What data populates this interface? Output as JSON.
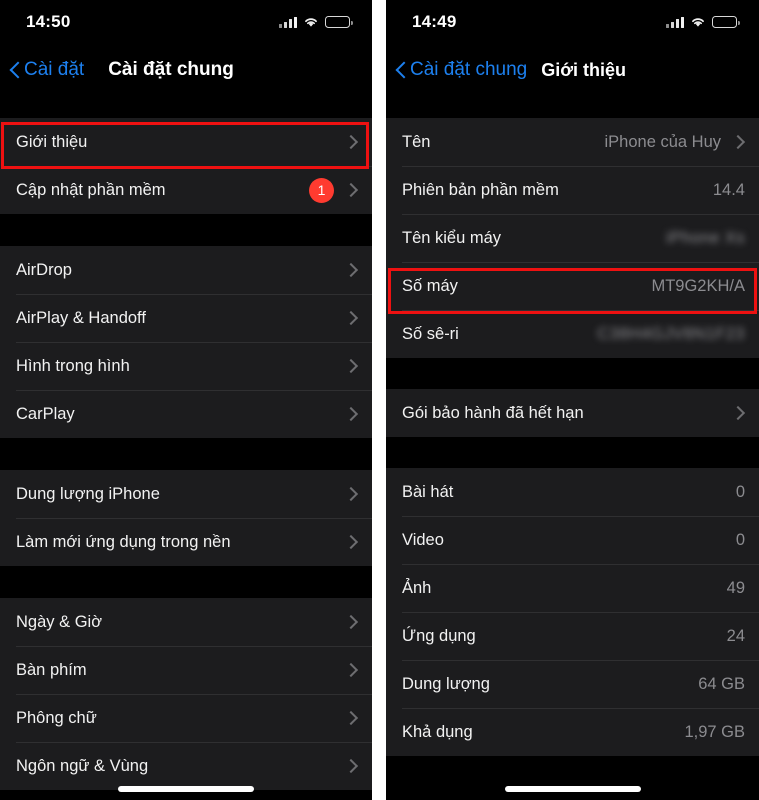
{
  "left_phone": {
    "status_bar": {
      "time": "14:50",
      "signal_icon": "cellular-bars-icon",
      "wifi_icon": "wifi-icon",
      "battery_icon": "battery-icon"
    },
    "nav": {
      "back_label": "Cài đặt",
      "back_icon": "chevron-left-icon",
      "title": "Cài đặt chung"
    },
    "sections": [
      {
        "rows": [
          {
            "label": "Giới thiệu",
            "value": "",
            "accessory": "chevron",
            "highlighted": true
          },
          {
            "label": "Cập nhật phần mềm",
            "value": "",
            "accessory": "badge-chevron",
            "badge": "1"
          }
        ]
      },
      {
        "rows": [
          {
            "label": "AirDrop",
            "value": "",
            "accessory": "chevron"
          },
          {
            "label": "AirPlay & Handoff",
            "value": "",
            "accessory": "chevron"
          },
          {
            "label": "Hình trong hình",
            "value": "",
            "accessory": "chevron"
          },
          {
            "label": "CarPlay",
            "value": "",
            "accessory": "chevron"
          }
        ]
      },
      {
        "rows": [
          {
            "label": "Dung lượng iPhone",
            "value": "",
            "accessory": "chevron"
          },
          {
            "label": "Làm mới ứng dụng trong nền",
            "value": "",
            "accessory": "chevron"
          }
        ]
      },
      {
        "rows": [
          {
            "label": "Ngày & Giờ",
            "value": "",
            "accessory": "chevron"
          },
          {
            "label": "Bàn phím",
            "value": "",
            "accessory": "chevron"
          },
          {
            "label": "Phông chữ",
            "value": "",
            "accessory": "chevron"
          },
          {
            "label": "Ngôn ngữ & Vùng",
            "value": "",
            "accessory": "chevron"
          }
        ]
      }
    ]
  },
  "right_phone": {
    "status_bar": {
      "time": "14:49",
      "signal_icon": "cellular-bars-icon",
      "wifi_icon": "wifi-icon",
      "battery_icon": "battery-icon"
    },
    "nav": {
      "back_label": "Cài đặt chung",
      "back_icon": "chevron-left-icon",
      "title": "Giới thiệu"
    },
    "sections": [
      {
        "rows": [
          {
            "label": "Tên",
            "value": "iPhone của Huy",
            "accessory": "chevron"
          },
          {
            "label": "Phiên bản phần mềm",
            "value": "14.4",
            "accessory": "none"
          },
          {
            "label": "Tên kiểu máy",
            "value": "iPhone Xs",
            "accessory": "none",
            "blurred": true
          },
          {
            "label": "Số máy",
            "value": "MT9G2KH/A",
            "accessory": "none",
            "highlighted": true
          },
          {
            "label": "Số sê-ri",
            "value": "C38H4GJV8N1F23",
            "accessory": "none",
            "blurred": true
          }
        ]
      },
      {
        "rows": [
          {
            "label": "Gói bảo hành đã hết hạn",
            "value": "",
            "accessory": "chevron"
          }
        ]
      },
      {
        "rows": [
          {
            "label": "Bài hát",
            "value": "0",
            "accessory": "none"
          },
          {
            "label": "Video",
            "value": "0",
            "accessory": "none"
          },
          {
            "label": "Ảnh",
            "value": "49",
            "accessory": "none"
          },
          {
            "label": "Ứng dụng",
            "value": "24",
            "accessory": "none"
          },
          {
            "label": "Dung lượng",
            "value": "64 GB",
            "accessory": "none"
          },
          {
            "label": "Khả dụng",
            "value": "1,97 GB",
            "accessory": "none"
          }
        ]
      }
    ]
  },
  "annotations": {
    "highlight_color": "#ee1111",
    "left_highlight_target": "Giới thiệu",
    "right_highlight_target": "Số máy"
  }
}
